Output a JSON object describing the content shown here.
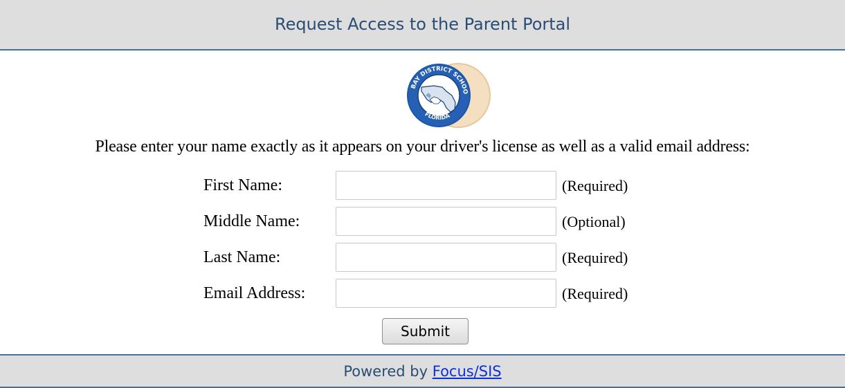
{
  "header": {
    "title": "Request Access to the Parent Portal"
  },
  "logo": {
    "icon": "bay-district-schools-seal",
    "text_top": "BAY DISTRICT SCHOOLS",
    "text_bottom": "FLORIDA"
  },
  "instructions": "Please enter your name exactly as it appears on your driver's license as well as a valid email address:",
  "form": {
    "fields": [
      {
        "label": "First Name:",
        "value": "",
        "note": "(Required)"
      },
      {
        "label": "Middle Name:",
        "value": "",
        "note": "(Optional)"
      },
      {
        "label": "Last Name:",
        "value": "",
        "note": "(Required)"
      },
      {
        "label": "Email Address:",
        "value": "",
        "note": "(Required)"
      }
    ],
    "submit_label": "Submit"
  },
  "footer": {
    "prefix": "Powered by ",
    "link_text": "Focus/SIS"
  },
  "colors": {
    "header_bg": "#dedede",
    "border_accent": "#46709a",
    "title_text": "#2a4d74",
    "link": "#0d2fd8"
  }
}
